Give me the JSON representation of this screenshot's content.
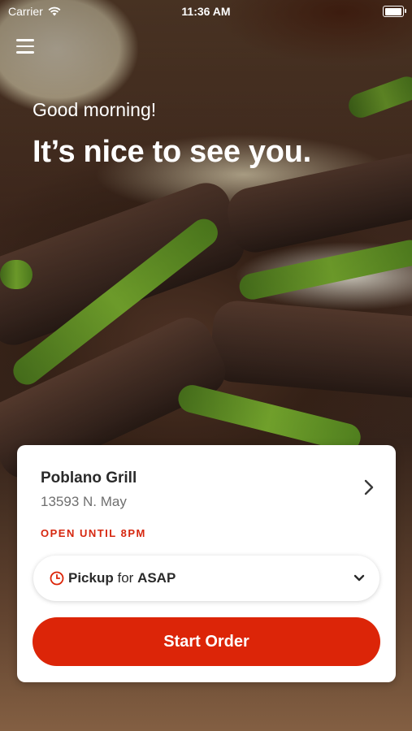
{
  "status_bar": {
    "carrier": "Carrier",
    "time": "11:36 AM",
    "icons": [
      "wifi-icon",
      "battery-icon"
    ]
  },
  "header": {
    "menu_icon": "hamburger-menu-icon",
    "greeting": "Good morning!",
    "headline": "It’s nice to see you."
  },
  "store_card": {
    "name": "Poblano Grill",
    "address": "13593 N. May",
    "open_status": "OPEN UNTIL 8PM",
    "chevron_icon": "chevron-right-icon",
    "pickup": {
      "icon": "clock-icon",
      "mode": "Pickup",
      "connector": "for",
      "time": "ASAP",
      "chevron_icon": "chevron-down-icon"
    },
    "start_order_label": "Start Order"
  },
  "colors": {
    "accent": "#dc2508",
    "open_status": "#d6270f",
    "text_primary": "#2a2a2a",
    "text_secondary": "#6f6f6f"
  }
}
